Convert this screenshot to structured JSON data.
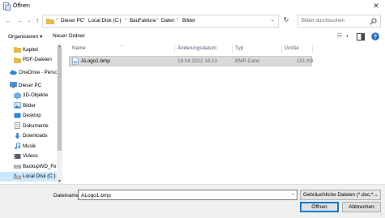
{
  "window": {
    "title": "Öffnen",
    "close_label": "✕"
  },
  "address": {
    "crumbs": [
      "Dieser PC",
      "Local Disk (C:)",
      "BauFaktura",
      "Daten",
      "Bilder"
    ],
    "separator": "›",
    "search_placeholder": "Bilder durchsuchen"
  },
  "toolbar": {
    "organize_label": "Organisieren ▾",
    "new_folder_label": "Neuer Ordner"
  },
  "nav": {
    "items": [
      {
        "label": "Kapitel",
        "icon": "folder-icon"
      },
      {
        "label": "PDF-Dateien",
        "icon": "folder-icon"
      },
      {
        "label": "OneDrive - Persor",
        "icon": "cloud-icon"
      },
      {
        "label": "Dieser PC",
        "icon": "computer-icon"
      },
      {
        "label": "3D-Objekte",
        "icon": "cube-icon"
      },
      {
        "label": "Bilder",
        "icon": "pictures-icon"
      },
      {
        "label": "Desktop",
        "icon": "desktop-icon"
      },
      {
        "label": "Dokumente",
        "icon": "documents-icon"
      },
      {
        "label": "Downloads",
        "icon": "download-icon"
      },
      {
        "label": "Musik",
        "icon": "music-icon"
      },
      {
        "label": "Videos",
        "icon": "video-icon"
      },
      {
        "label": "BackupWD_Felix",
        "icon": "drive-icon"
      },
      {
        "label": "Local Disk (C:)",
        "icon": "drive-icon"
      }
    ]
  },
  "list": {
    "columns": [
      "Name",
      "Änderungsdatum",
      "Typ",
      "Größe"
    ],
    "files": [
      {
        "name": "ALogo1.bmp",
        "date": "19.04.2022 16:13",
        "type": "BMP-Datei",
        "size": "151 KB"
      }
    ]
  },
  "bottom": {
    "filename_label": "Dateiname:",
    "filename_value": "ALogo1.bmp",
    "filetype_value": "Gebräuchliche Dateien (*.doc;*.",
    "open_label": "Öffnen",
    "cancel_label": "Abbrechen"
  },
  "colors": {
    "accent": "#0078d7",
    "selection": "#cce8ff",
    "folder": "#e8b84a"
  }
}
